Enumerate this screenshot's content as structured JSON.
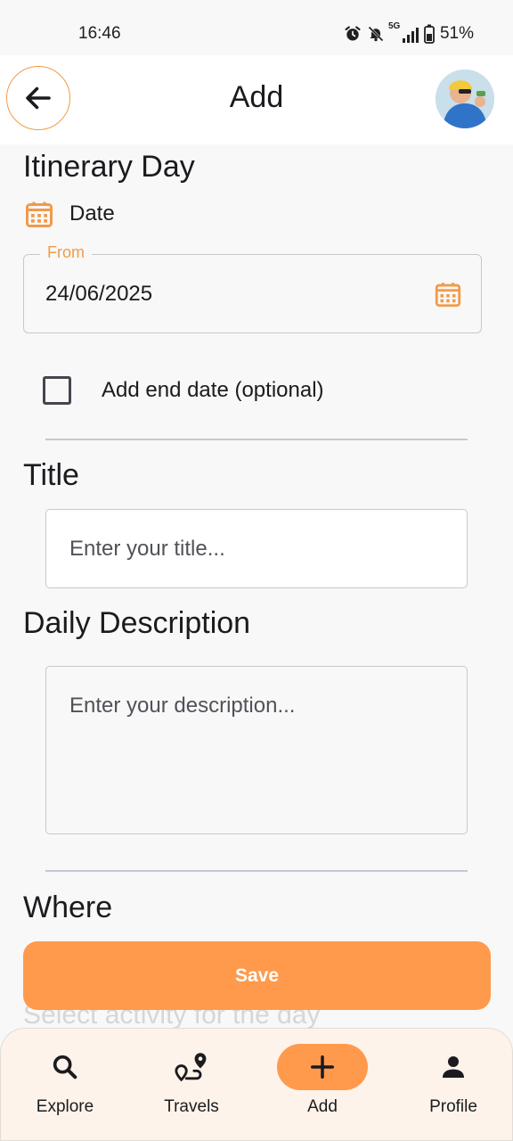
{
  "status_bar": {
    "time": "16:46",
    "network": "5G",
    "battery": "51%"
  },
  "header": {
    "title": "Add"
  },
  "form": {
    "itinerary_title": "Itinerary Day",
    "date_label": "Date",
    "from_label": "From",
    "from_value": "24/06/2025",
    "end_date_label": "Add end date (optional)",
    "end_date_checked": false,
    "title_heading": "Title",
    "title_placeholder": "Enter your title...",
    "description_heading": "Daily Description",
    "description_placeholder": "Enter your description...",
    "where_heading": "Where",
    "activity_hint": "Select activity for the day",
    "save_label": "Save"
  },
  "nav": [
    {
      "label": "Explore",
      "icon": "search-icon"
    },
    {
      "label": "Travels",
      "icon": "route-icon"
    },
    {
      "label": "Add",
      "icon": "plus-icon",
      "active": true
    },
    {
      "label": "Profile",
      "icon": "person-icon"
    }
  ],
  "colors": {
    "accent": "#ff9a4d",
    "outline": "#f29a4a",
    "nav_bg": "#fdf3ea"
  }
}
